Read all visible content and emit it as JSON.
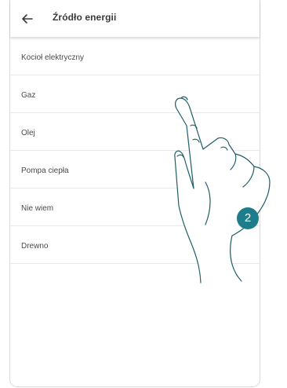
{
  "header": {
    "title": "Źródło energii",
    "back_icon": "arrow-left-icon"
  },
  "energy_sources": [
    {
      "label": "Kocioł elektryczny"
    },
    {
      "label": "Gaz"
    },
    {
      "label": "Olej"
    },
    {
      "label": "Pompa ciepła"
    },
    {
      "label": "Nie wiem"
    },
    {
      "label": "Drewno"
    }
  ],
  "instruction": {
    "step_number": "2",
    "badge_color": "#1d7d8a",
    "tap_indicator_color": "#f6b26b"
  }
}
